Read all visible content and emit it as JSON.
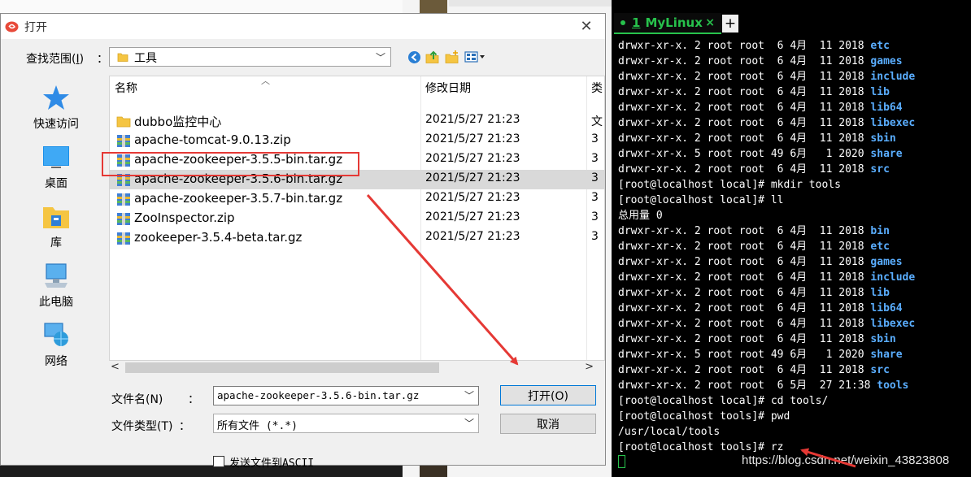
{
  "dialog": {
    "title": "打开",
    "close_glyph": "✕",
    "look_in": {
      "label_text": "查找范围",
      "mnemonic": "I",
      "colon": "：",
      "value": "工具"
    },
    "places": [
      {
        "label": "快速访问",
        "icon": "star-icon"
      },
      {
        "label": "桌面",
        "icon": "desktop-icon"
      },
      {
        "label": "库",
        "icon": "library-icon"
      },
      {
        "label": "此电脑",
        "icon": "computer-icon"
      },
      {
        "label": "网络",
        "icon": "network-icon"
      }
    ],
    "columns": {
      "name": "名称",
      "date": "修改日期",
      "type": "类"
    },
    "files": [
      {
        "name": "dubbo监控中心",
        "date": "2021/5/27 21:23",
        "type": "文",
        "icon": "folder-icon"
      },
      {
        "name": "apache-tomcat-9.0.13.zip",
        "date": "2021/5/27 21:23",
        "type": "3",
        "icon": "archive-icon"
      },
      {
        "name": "apache-zookeeper-3.5.5-bin.tar.gz",
        "date": "2021/5/27 21:23",
        "type": "3",
        "icon": "archive-icon"
      },
      {
        "name": "apache-zookeeper-3.5.6-bin.tar.gz",
        "date": "2021/5/27 21:23",
        "type": "3",
        "icon": "archive-icon",
        "selected": true
      },
      {
        "name": "apache-zookeeper-3.5.7-bin.tar.gz",
        "date": "2021/5/27 21:23",
        "type": "3",
        "icon": "archive-icon"
      },
      {
        "name": "ZooInspector.zip",
        "date": "2021/5/27 21:23",
        "type": "3",
        "icon": "archive-icon"
      },
      {
        "name": "zookeeper-3.5.4-beta.tar.gz",
        "date": "2021/5/27 21:23",
        "type": "3",
        "icon": "archive-icon"
      }
    ],
    "filename_label": "文件名(N)",
    "filename_colon": "：",
    "filename_value": "apache-zookeeper-3.5.6-bin.tar.gz",
    "filetype_label": "文件类型(T)",
    "filetype_colon": "：",
    "filetype_value": "所有文件 (*.*)",
    "open_button": "打开(O)",
    "cancel_button": "取消",
    "ascii_checkbox_label": "发送文件到ASCII",
    "accent_color": "#0078d7",
    "highlight_color": "#e53935"
  },
  "terminal": {
    "tab_number": "1",
    "tab_name": "MyLinux",
    "tab_close": "×",
    "new_tab": "+",
    "lines": [
      {
        "text": "drwxr-xr-x. 2 root root  6 4月  11 2018 ",
        "name": "etc"
      },
      {
        "text": "drwxr-xr-x. 2 root root  6 4月  11 2018 ",
        "name": "games"
      },
      {
        "text": "drwxr-xr-x. 2 root root  6 4月  11 2018 ",
        "name": "include"
      },
      {
        "text": "drwxr-xr-x. 2 root root  6 4月  11 2018 ",
        "name": "lib"
      },
      {
        "text": "drwxr-xr-x. 2 root root  6 4月  11 2018 ",
        "name": "lib64"
      },
      {
        "text": "drwxr-xr-x. 2 root root  6 4月  11 2018 ",
        "name": "libexec"
      },
      {
        "text": "drwxr-xr-x. 2 root root  6 4月  11 2018 ",
        "name": "sbin"
      },
      {
        "text": "drwxr-xr-x. 5 root root 49 6月   1 2020 ",
        "name": "share"
      },
      {
        "text": "drwxr-xr-x. 2 root root  6 4月  11 2018 ",
        "name": "src"
      },
      {
        "text": "[root@localhost local]# mkdir tools",
        "name": ""
      },
      {
        "text": "[root@localhost local]# ll",
        "name": ""
      },
      {
        "text": "总用量 0",
        "name": ""
      },
      {
        "text": "drwxr-xr-x. 2 root root  6 4月  11 2018 ",
        "name": "bin"
      },
      {
        "text": "drwxr-xr-x. 2 root root  6 4月  11 2018 ",
        "name": "etc"
      },
      {
        "text": "drwxr-xr-x. 2 root root  6 4月  11 2018 ",
        "name": "games"
      },
      {
        "text": "drwxr-xr-x. 2 root root  6 4月  11 2018 ",
        "name": "include"
      },
      {
        "text": "drwxr-xr-x. 2 root root  6 4月  11 2018 ",
        "name": "lib"
      },
      {
        "text": "drwxr-xr-x. 2 root root  6 4月  11 2018 ",
        "name": "lib64"
      },
      {
        "text": "drwxr-xr-x. 2 root root  6 4月  11 2018 ",
        "name": "libexec"
      },
      {
        "text": "drwxr-xr-x. 2 root root  6 4月  11 2018 ",
        "name": "sbin"
      },
      {
        "text": "drwxr-xr-x. 5 root root 49 6月   1 2020 ",
        "name": "share"
      },
      {
        "text": "drwxr-xr-x. 2 root root  6 4月  11 2018 ",
        "name": "src"
      },
      {
        "text": "drwxr-xr-x. 2 root root  6 5月  27 21:38 ",
        "name": "tools"
      },
      {
        "text": "[root@localhost local]# cd tools/",
        "name": ""
      },
      {
        "text": "[root@localhost tools]# pwd",
        "name": ""
      },
      {
        "text": "/usr/local/tools",
        "name": ""
      },
      {
        "text": "[root@localhost tools]# rz",
        "name": ""
      }
    ],
    "text_color": "#ffffff",
    "dir_color": "#5aaeff",
    "tab_color": "#27c24c"
  },
  "watermark": "https://blog.csdn.net/weixin_43823808"
}
